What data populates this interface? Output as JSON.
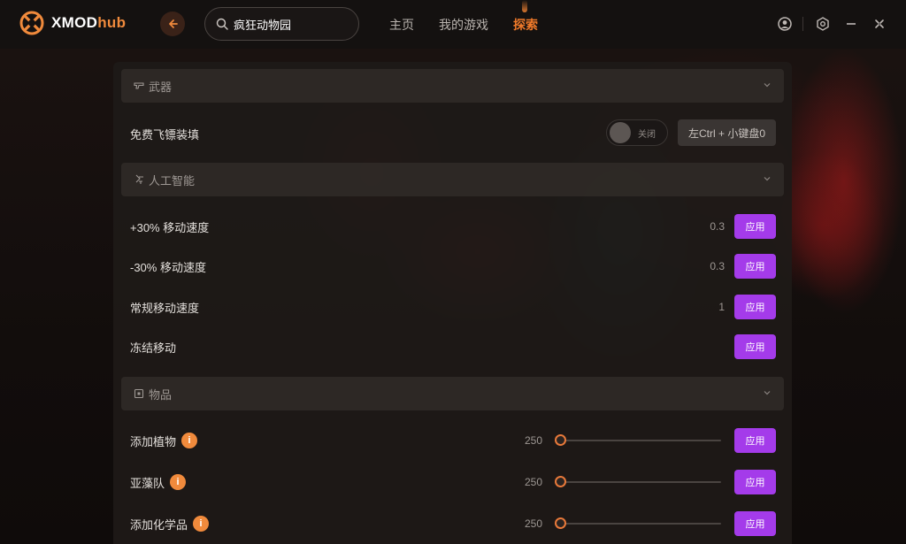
{
  "app": {
    "logo_main": "XMOD",
    "logo_accent": "hub"
  },
  "search": {
    "value": "疯狂动物园",
    "placeholder": ""
  },
  "nav": {
    "items": [
      {
        "label": "主页",
        "active": false
      },
      {
        "label": "我的游戏",
        "active": false
      },
      {
        "label": "探索",
        "active": true
      }
    ]
  },
  "sections": [
    {
      "title": "武器",
      "icon": "gun-icon",
      "rows": [
        {
          "label": "免费飞镖装填",
          "type": "toggle",
          "toggle_label": "关闭",
          "toggle_on": false,
          "hotkey": "左Ctrl + 小键盘0"
        }
      ]
    },
    {
      "title": "人工智能",
      "icon": "ai-icon",
      "rows": [
        {
          "label": "+30% 移动速度",
          "type": "apply",
          "value": "0.3",
          "apply_label": "应用"
        },
        {
          "label": "-30% 移动速度",
          "type": "apply",
          "value": "0.3",
          "apply_label": "应用"
        },
        {
          "label": "常规移动速度",
          "type": "apply",
          "value": "1",
          "apply_label": "应用"
        },
        {
          "label": "冻结移动",
          "type": "apply",
          "value": "",
          "apply_label": "应用"
        }
      ]
    },
    {
      "title": "物品",
      "icon": "item-icon",
      "rows": [
        {
          "label": "添加植物",
          "type": "slider",
          "value": "250",
          "info": "i",
          "slider_level": 0,
          "apply_label": "应用"
        },
        {
          "label": "亚藻队",
          "type": "slider",
          "value": "250",
          "info": "i",
          "slider_level": 0,
          "apply_label": "应用"
        },
        {
          "label": "添加化学品",
          "type": "slider",
          "value": "250",
          "info": "i",
          "slider_level": 0,
          "apply_label": "应用"
        }
      ]
    }
  ],
  "colors": {
    "accent_orange": "#f07a2a",
    "apply_purple": "#a43bea",
    "background": "#0f0c0b"
  }
}
